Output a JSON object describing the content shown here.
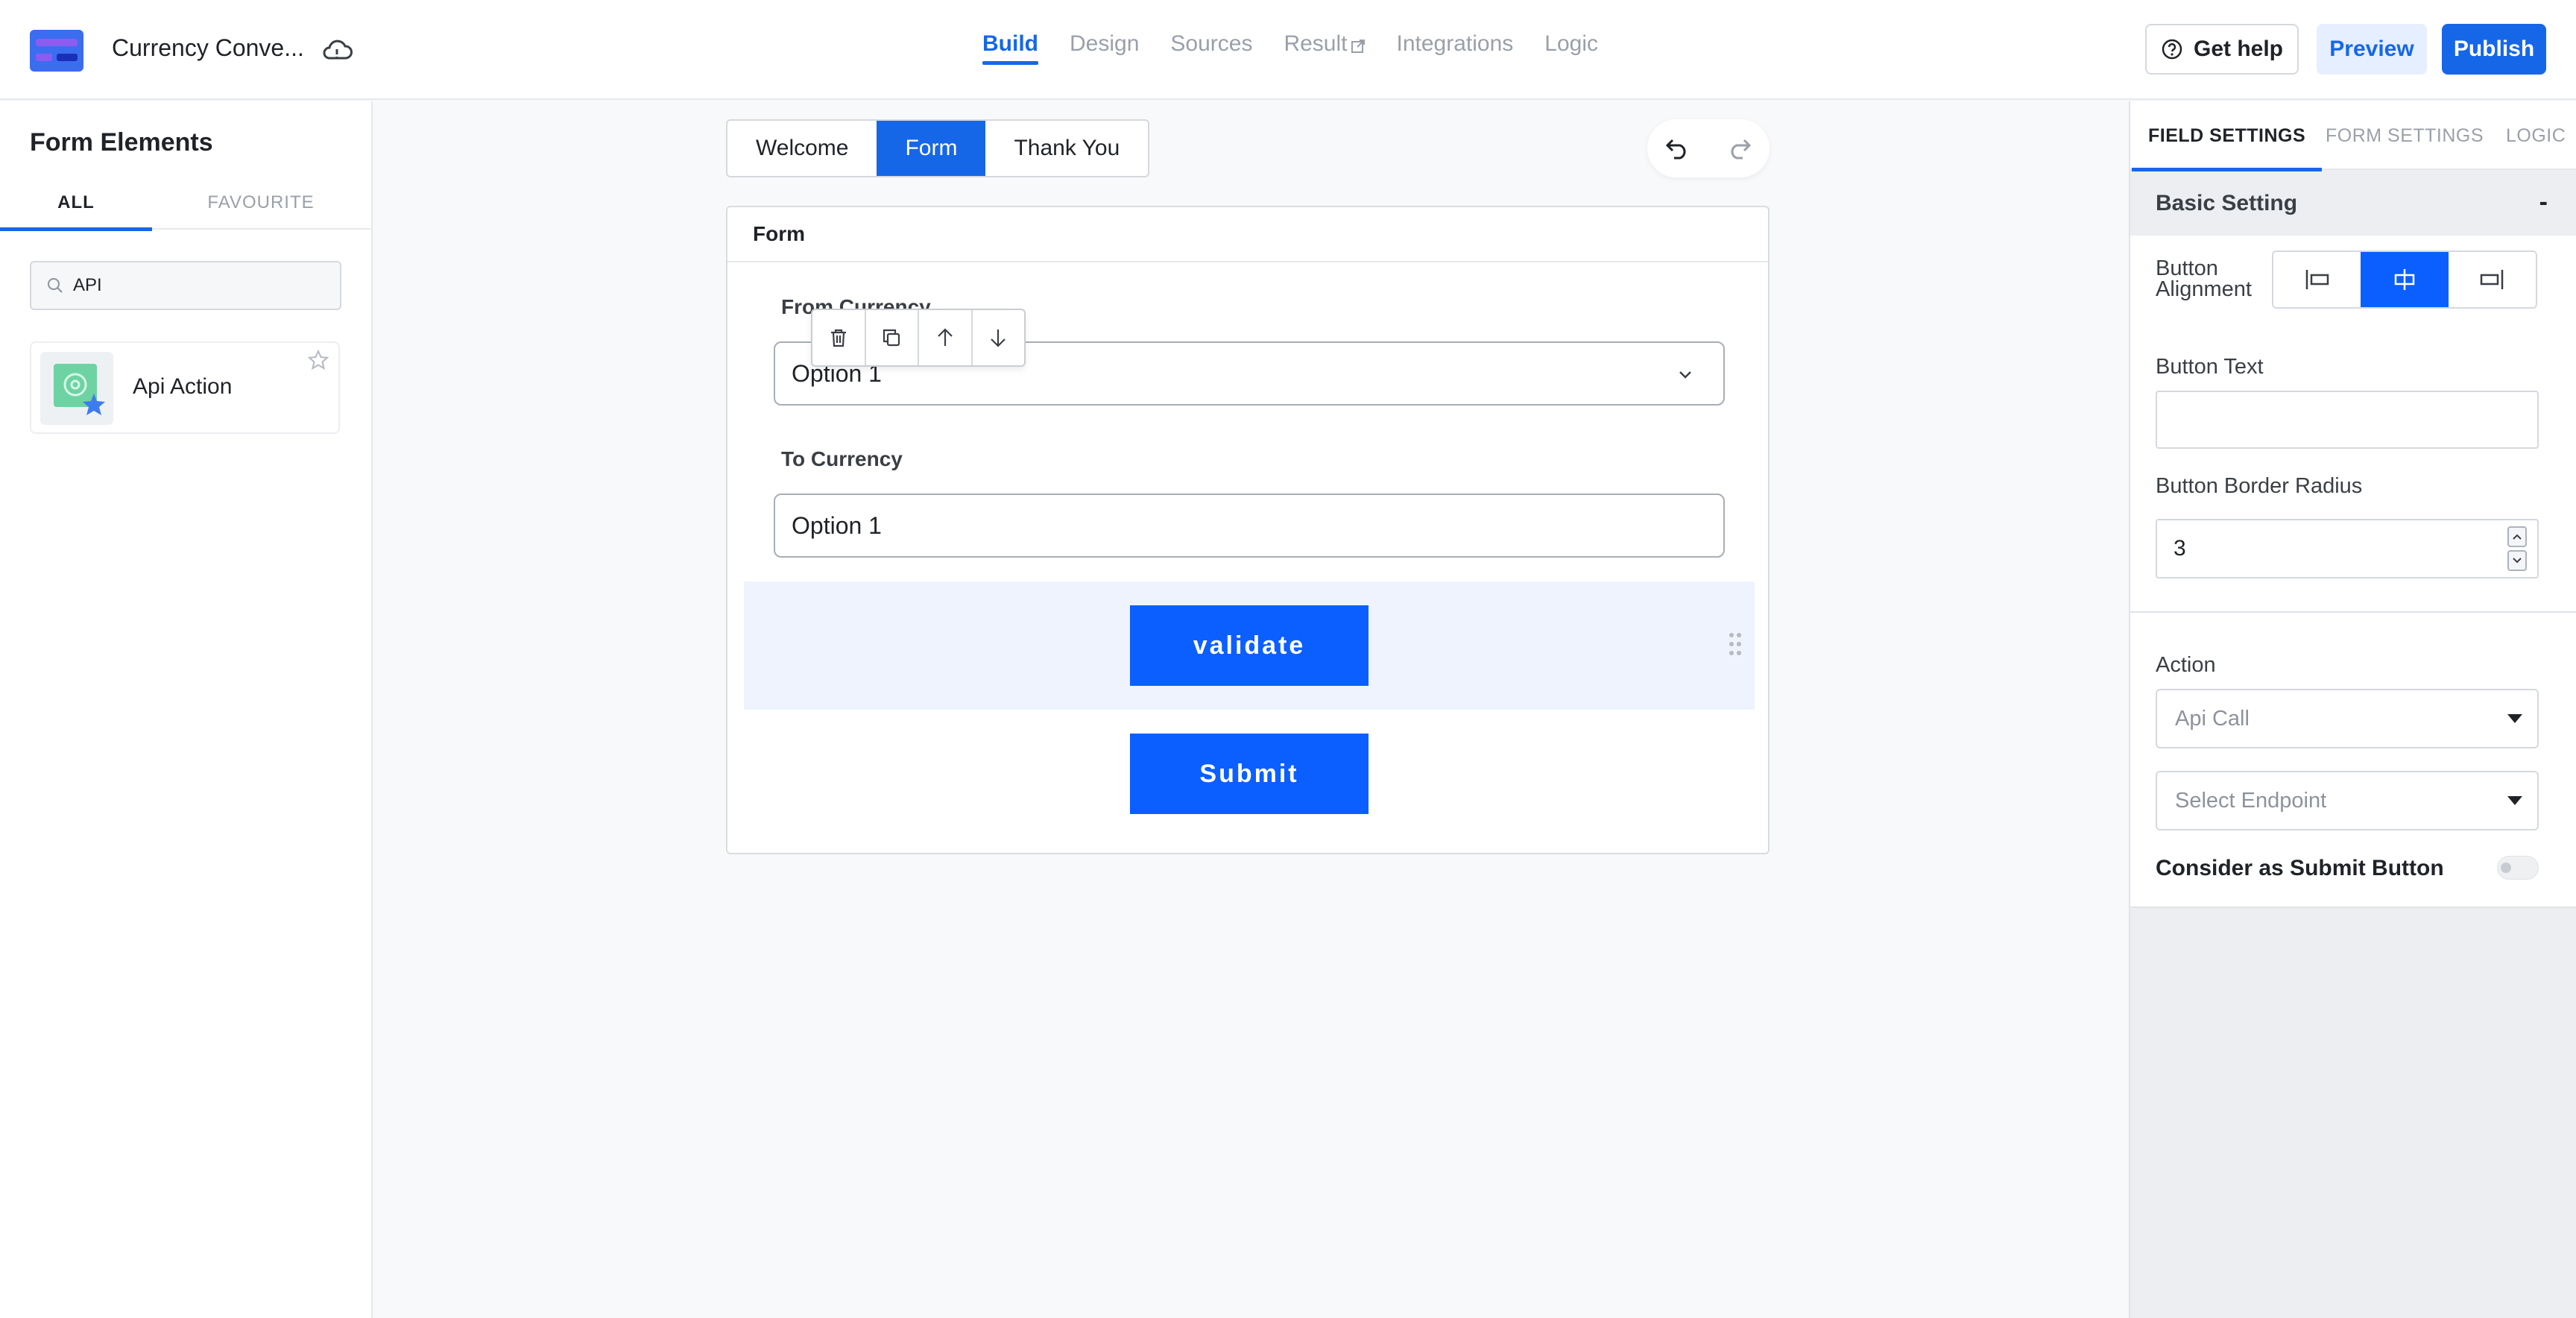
{
  "header": {
    "app_title": "Currency Conve...",
    "nav": [
      {
        "label": "Build",
        "active": true
      },
      {
        "label": "Design",
        "active": false
      },
      {
        "label": "Sources",
        "active": false
      },
      {
        "label": "Result",
        "active": false
      },
      {
        "label": "Integrations",
        "active": false
      },
      {
        "label": "Logic",
        "active": false
      }
    ],
    "help_label": "Get help",
    "preview_label": "Preview",
    "publish_label": "Publish"
  },
  "left_panel": {
    "title": "Form Elements",
    "tabs": [
      "ALL",
      "FAVOURITE"
    ],
    "search_value": "API",
    "elements": [
      {
        "label": "Api Action"
      }
    ]
  },
  "canvas": {
    "page_tabs": [
      "Welcome",
      "Form",
      "Thank You"
    ],
    "form_title": "Form",
    "fields": [
      {
        "label": "From Currency",
        "value": "Option 1"
      },
      {
        "label": "To Currency",
        "value": "Option 1"
      }
    ],
    "buttons": [
      "validate",
      "Submit"
    ]
  },
  "right_panel": {
    "tabs": [
      "FIELD SETTINGS",
      "FORM SETTINGS",
      "LOGIC"
    ],
    "section_title": "Basic Setting",
    "collapse_symbol": "-",
    "button_alignment_label": "Button Alignment",
    "button_text_label": "Button Text",
    "button_text_value": "",
    "border_radius_label": "Button Border Radius",
    "border_radius_value": "3",
    "action_label": "Action",
    "action_value": "Api Call",
    "endpoint_placeholder": "Select Endpoint",
    "submit_toggle_label": "Consider as Submit Button"
  },
  "colors": {
    "accent": "#1667e8",
    "button": "#0b5fff",
    "selected_bg": "#eef3fd"
  }
}
